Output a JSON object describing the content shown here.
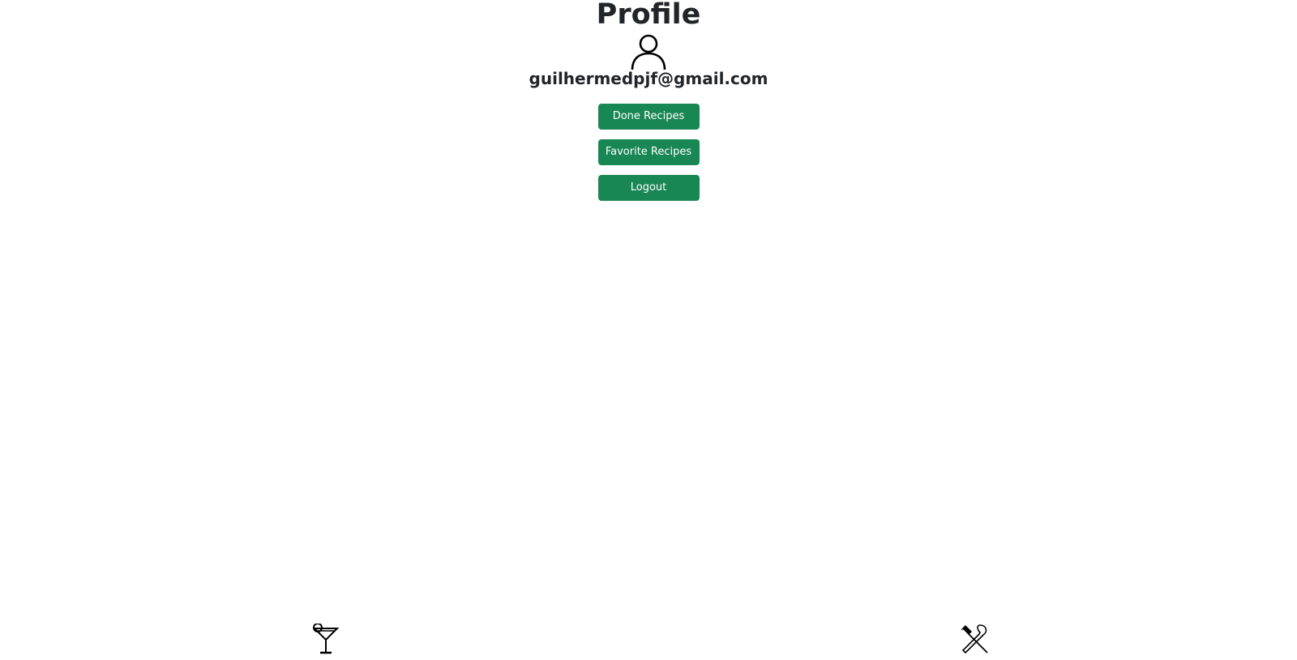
{
  "header": {
    "title": "Profile",
    "avatar_icon": "profile-icon"
  },
  "user": {
    "email": "guilhermedpjf@gmail.com"
  },
  "actions": {
    "done_recipes_label": "Done Recipes",
    "favorite_recipes_label": "Favorite Recipes",
    "logout_label": "Logout",
    "button_color": "#198754"
  },
  "footer": {
    "drinks_icon": "drink-icon",
    "meals_icon": "meal-icon"
  }
}
